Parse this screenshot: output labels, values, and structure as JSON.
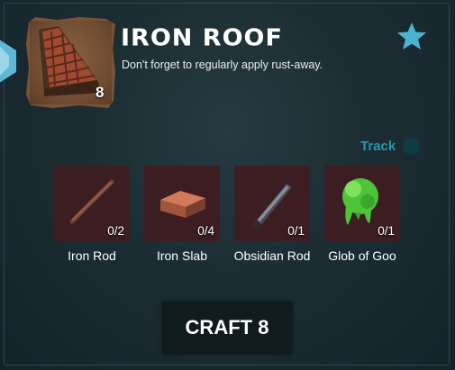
{
  "item": {
    "name": "IRON ROOF",
    "description": "Don't forget to regularly apply rust-away.",
    "quantity": "8",
    "icon": "iron-roof-icon"
  },
  "favorite": {
    "icon": "star-icon",
    "color": "#4bb3d0"
  },
  "track": {
    "label": "Track",
    "enabled": false
  },
  "ingredients": [
    {
      "name": "Iron Rod",
      "count": "0/2",
      "icon": "iron-rod-icon"
    },
    {
      "name": "Iron Slab",
      "count": "0/4",
      "icon": "iron-slab-icon"
    },
    {
      "name": "Obsidian Rod",
      "count": "0/1",
      "icon": "obsidian-rod-icon"
    },
    {
      "name": "Glob of Goo",
      "count": "0/1",
      "icon": "glob-of-goo-icon"
    }
  ],
  "craft": {
    "label": "CRAFT 8"
  },
  "colors": {
    "accent": "#2a97ad",
    "slot_background": "#3c1d21",
    "panel_background": "#1b2d33"
  }
}
